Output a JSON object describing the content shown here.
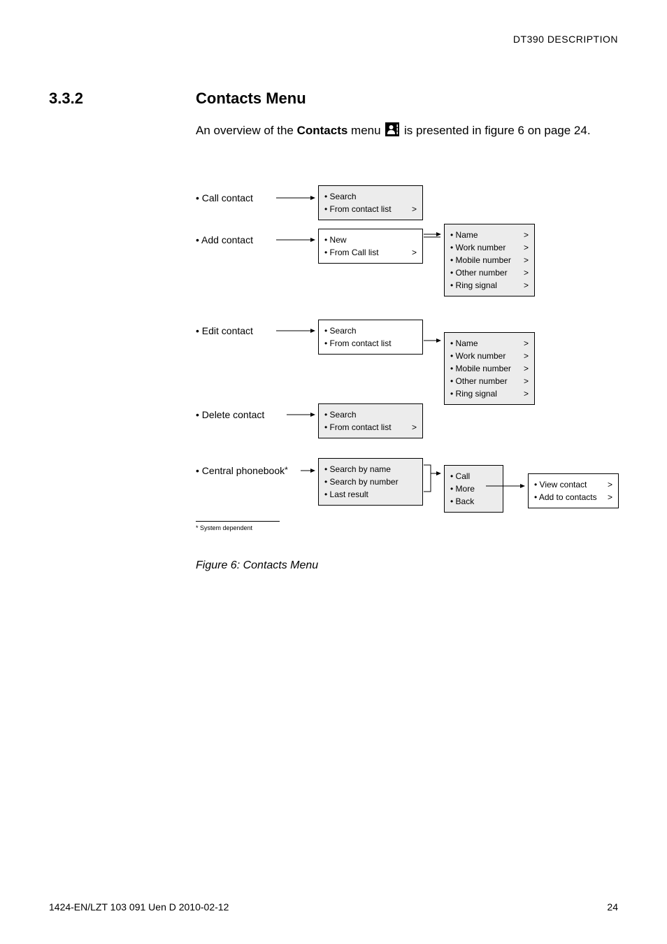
{
  "running_head": "DT390 DESCRIPTION",
  "section": {
    "number": "3.3.2",
    "title": "Contacts Menu"
  },
  "intro": {
    "pre": "An overview of the ",
    "bold": "Contacts",
    "mid": " menu ",
    "post": " is presented in figure 6 on page 24."
  },
  "diagram": {
    "root": {
      "call": "• Call contact",
      "add": "• Add contact",
      "edit": "• Edit contact",
      "delete": "• Delete contact",
      "central": "• Central phonebook",
      "central_mark": "*"
    },
    "call_box": {
      "l1": "• Search",
      "l2": "• From contact list"
    },
    "add_box": {
      "l1": "• New",
      "l2": "• From Call list"
    },
    "add_detail": {
      "l1": "• Name",
      "l2": "• Work number",
      "l3": "• Mobile number",
      "l4": "• Other number",
      "l5": "• Ring signal"
    },
    "edit_box": {
      "l1": "• Search",
      "l2": "• From contact list"
    },
    "edit_detail": {
      "l1": "• Name",
      "l2": "• Work number",
      "l3": "• Mobile number",
      "l4": "• Other number",
      "l5": "• Ring signal"
    },
    "delete_box": {
      "l1": "• Search",
      "l2": "• From contact list"
    },
    "central_box": {
      "l1": "• Search by name",
      "l2": "• Search by number",
      "l3": "• Last result"
    },
    "central_call": {
      "l1": "• Call",
      "l2": "• More",
      "l3": "• Back"
    },
    "central_more": {
      "l1": "• View contact",
      "l2": "• Add to contacts"
    },
    "gt": ">",
    "footnote": "* System dependent"
  },
  "caption": "Figure 6:  Contacts Menu",
  "footer": {
    "left": "1424-EN/LZT 103 091 Uen D 2010-02-12",
    "right": "24"
  }
}
